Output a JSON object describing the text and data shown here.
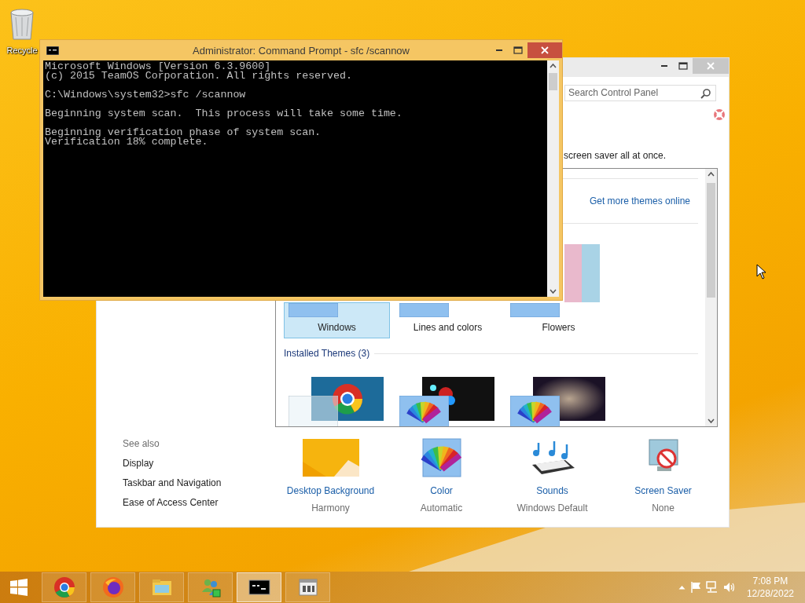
{
  "desktop": {
    "icons": [
      {
        "label": "Recycle"
      }
    ]
  },
  "control_panel": {
    "search": {
      "placeholder": "Search Control Panel"
    },
    "description": "screen saver all at once.",
    "themes_link": "Get more themes online",
    "my_themes": [
      {
        "name": "Windows",
        "kind": "windows",
        "selected": true
      },
      {
        "name": "Lines and colors",
        "kind": "lines",
        "selected": false
      },
      {
        "name": "Flowers",
        "kind": "flowers",
        "selected": false
      }
    ],
    "installed_heading": "Installed Themes (3)",
    "installed_themes": [
      {
        "kind": "chrome",
        "selected": false
      },
      {
        "kind": "dark",
        "selected": false
      },
      {
        "kind": "nebula",
        "selected": false
      }
    ],
    "see_also": {
      "heading": "See also",
      "links": [
        "Display",
        "Taskbar and Navigation",
        "Ease of Access Center"
      ]
    },
    "settings": [
      {
        "kind": "background",
        "label": "Desktop Background",
        "value": "Harmony"
      },
      {
        "kind": "color",
        "label": "Color",
        "value": "Automatic"
      },
      {
        "kind": "sounds",
        "label": "Sounds",
        "value": "Windows Default"
      },
      {
        "kind": "screensaver",
        "label": "Screen Saver",
        "value": "None"
      }
    ]
  },
  "command_prompt": {
    "title": "Administrator: Command Prompt - sfc  /scannow",
    "paragraphs": [
      [
        "Microsoft Windows [Version 6.3.9600]",
        "(c) 2015 TeamOS Corporation. All rights reserved."
      ],
      [
        "C:\\Windows\\system32>sfc /scannow"
      ],
      [
        "Beginning system scan.  This process will take some time."
      ],
      [
        "Beginning verification phase of system scan.",
        "Verification 18% complete."
      ]
    ]
  },
  "taskbar": {
    "apps": [
      {
        "kind": "chrome",
        "active": false
      },
      {
        "kind": "firefox",
        "active": false
      },
      {
        "kind": "explorer",
        "active": false
      },
      {
        "kind": "users",
        "active": false
      },
      {
        "kind": "cmd",
        "active": true
      },
      {
        "kind": "panel",
        "active": false
      }
    ],
    "clock": {
      "time": "7:08 PM",
      "date": "12/28/2022"
    }
  }
}
